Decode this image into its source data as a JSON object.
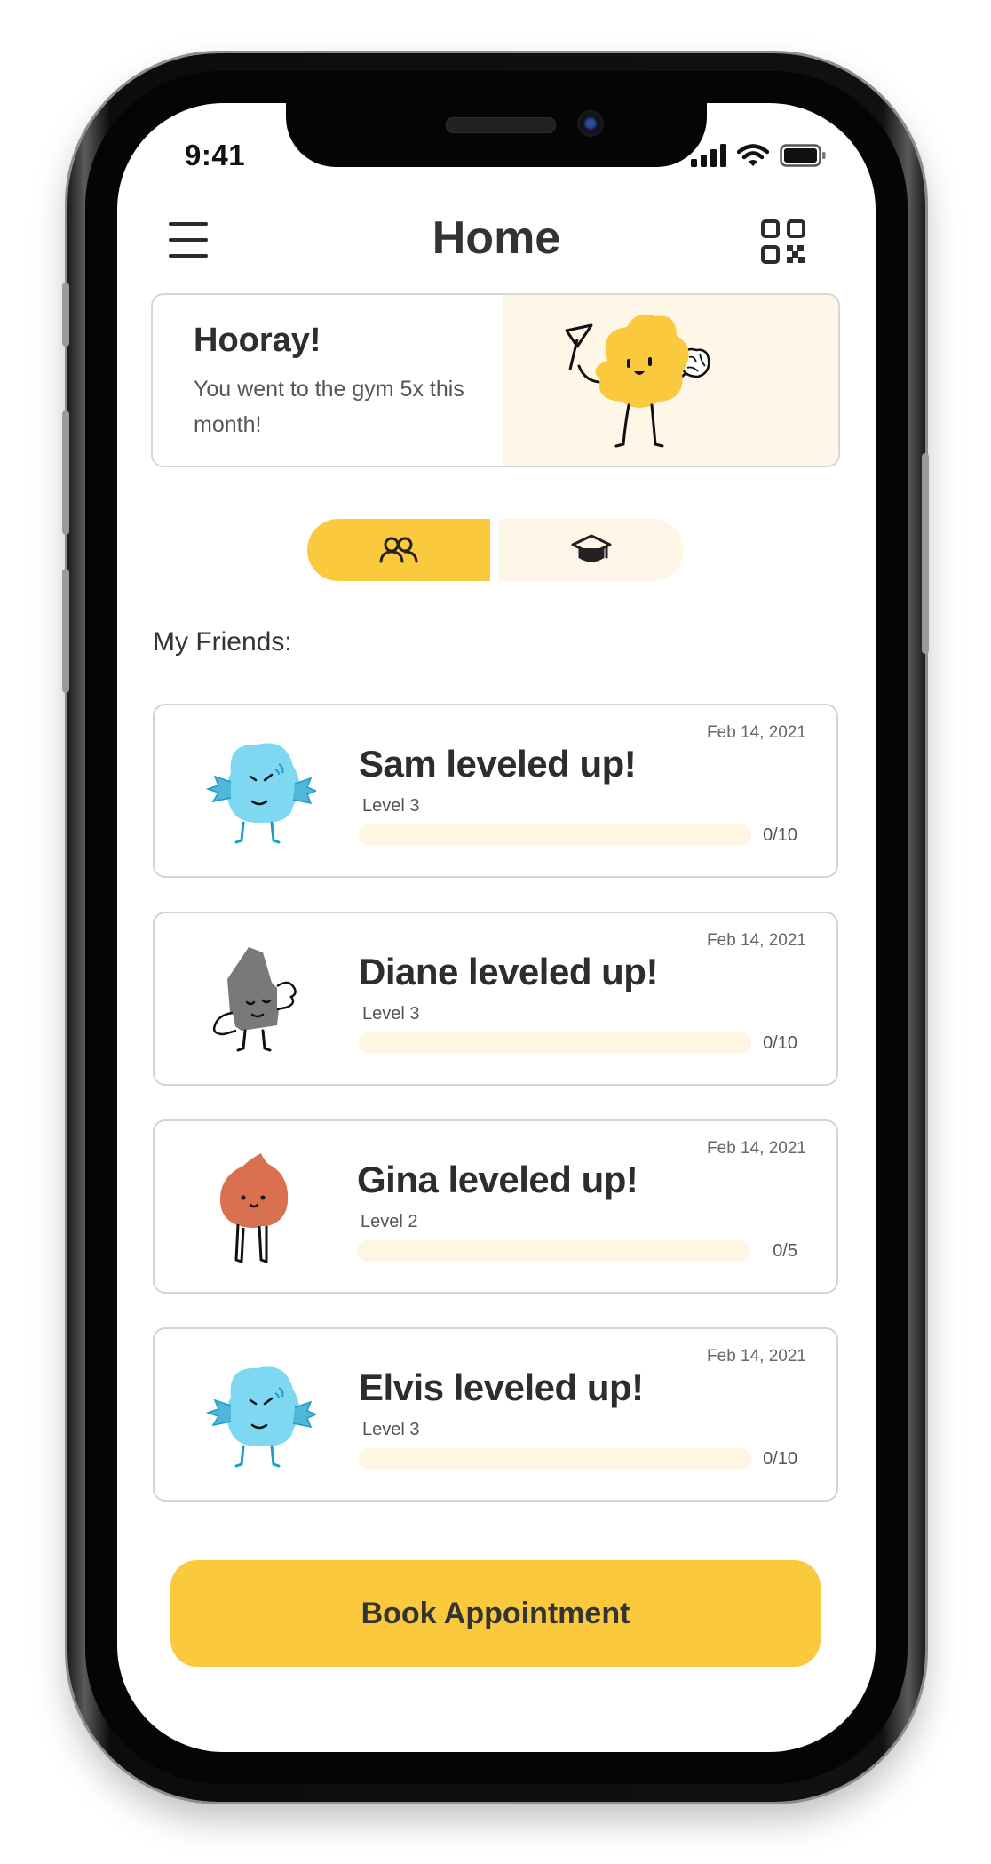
{
  "status": {
    "time": "9:41"
  },
  "header": {
    "title": "Home"
  },
  "hero": {
    "title": "Hooray!",
    "message": "You went to the gym 5x this month!"
  },
  "tabs": [
    {
      "icon": "friends-icon",
      "active": true
    },
    {
      "icon": "graduation-cap-icon",
      "active": false
    }
  ],
  "friends_label": "My Friends:",
  "friends": [
    {
      "title": "Sam leveled up!",
      "level": "Level 3",
      "date": "Feb 14, 2021",
      "count": "0/10",
      "progress": 0,
      "avatar": "blue-fish-avatar"
    },
    {
      "title": "Diane leveled up!",
      "level": "Level 3",
      "date": "Feb 14, 2021",
      "count": "0/10",
      "progress": 0,
      "avatar": "gray-rock-avatar"
    },
    {
      "title": "Gina leveled up!",
      "level": "Level 2",
      "date": "Feb 14, 2021",
      "count": "0/5",
      "progress": 0,
      "avatar": "orange-drop-avatar"
    },
    {
      "title": "Elvis leveled up!",
      "level": "Level 3",
      "date": "Feb 14, 2021",
      "count": "0/10",
      "progress": 0,
      "avatar": "blue-fish-avatar"
    }
  ],
  "cta": {
    "label": "Book Appointment"
  },
  "colors": {
    "accent": "#fac93e",
    "accent_light": "#fef6e6",
    "blue": "#7fd8f2",
    "gray": "#7a7878",
    "orange": "#d9704f"
  }
}
